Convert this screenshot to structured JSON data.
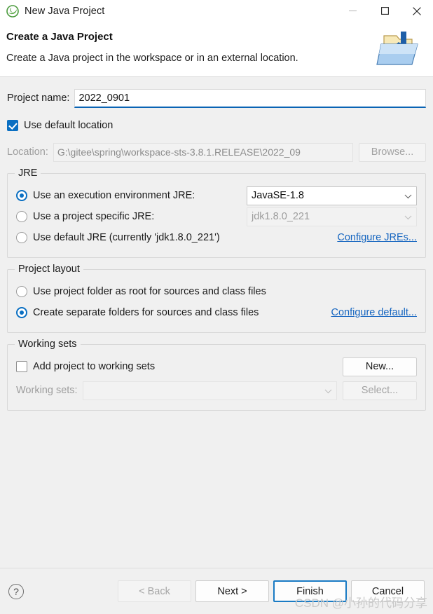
{
  "window": {
    "title": "New Java Project",
    "icon": "java-project-icon",
    "controls": {
      "minimize": "minimize-icon",
      "maximize": "maximize-icon",
      "close": "close-icon"
    }
  },
  "header": {
    "title": "Create a Java Project",
    "subtitle": "Create a Java project in the workspace or in an external location.",
    "icon": "new-java-project-folder-icon"
  },
  "project": {
    "name_label": "Project name:",
    "name_value": "2022_0901",
    "name_placeholder": "",
    "use_default_location_label": "Use default location",
    "use_default_location_checked": true,
    "location_label": "Location:",
    "location_value": "G:\\gitee\\spring\\workspace-sts-3.8.1.RELEASE\\2022_09",
    "browse_label": "Browse..."
  },
  "jre": {
    "group_title": "JRE",
    "options": [
      {
        "label": "Use an execution environment JRE:",
        "selected": true
      },
      {
        "label": "Use a project specific JRE:",
        "selected": false
      },
      {
        "label": "Use default JRE (currently 'jdk1.8.0_221')",
        "selected": false
      }
    ],
    "execution_env_value": "JavaSE-1.8",
    "project_jre_value": "jdk1.8.0_221",
    "configure_link": "Configure JREs..."
  },
  "layout": {
    "group_title": "Project layout",
    "options": [
      {
        "label": "Use project folder as root for sources and class files",
        "selected": false
      },
      {
        "label": "Create separate folders for sources and class files",
        "selected": true
      }
    ],
    "configure_link": "Configure default..."
  },
  "working_sets": {
    "group_title": "Working sets",
    "add_label": "Add project to working sets",
    "add_checked": false,
    "sets_label": "Working sets:",
    "sets_value": "",
    "new_label": "New...",
    "select_label": "Select..."
  },
  "footer": {
    "help_icon": "help-icon",
    "back_label": "< Back",
    "next_label": "Next >",
    "finish_label": "Finish",
    "cancel_label": "Cancel",
    "watermark": "CSDN @小孙的代码分享"
  },
  "colors": {
    "accent": "#0a6fc2",
    "link": "#1565c0",
    "focus_underline": "#0a64b4",
    "dialog_bg": "#f0f0f0"
  }
}
